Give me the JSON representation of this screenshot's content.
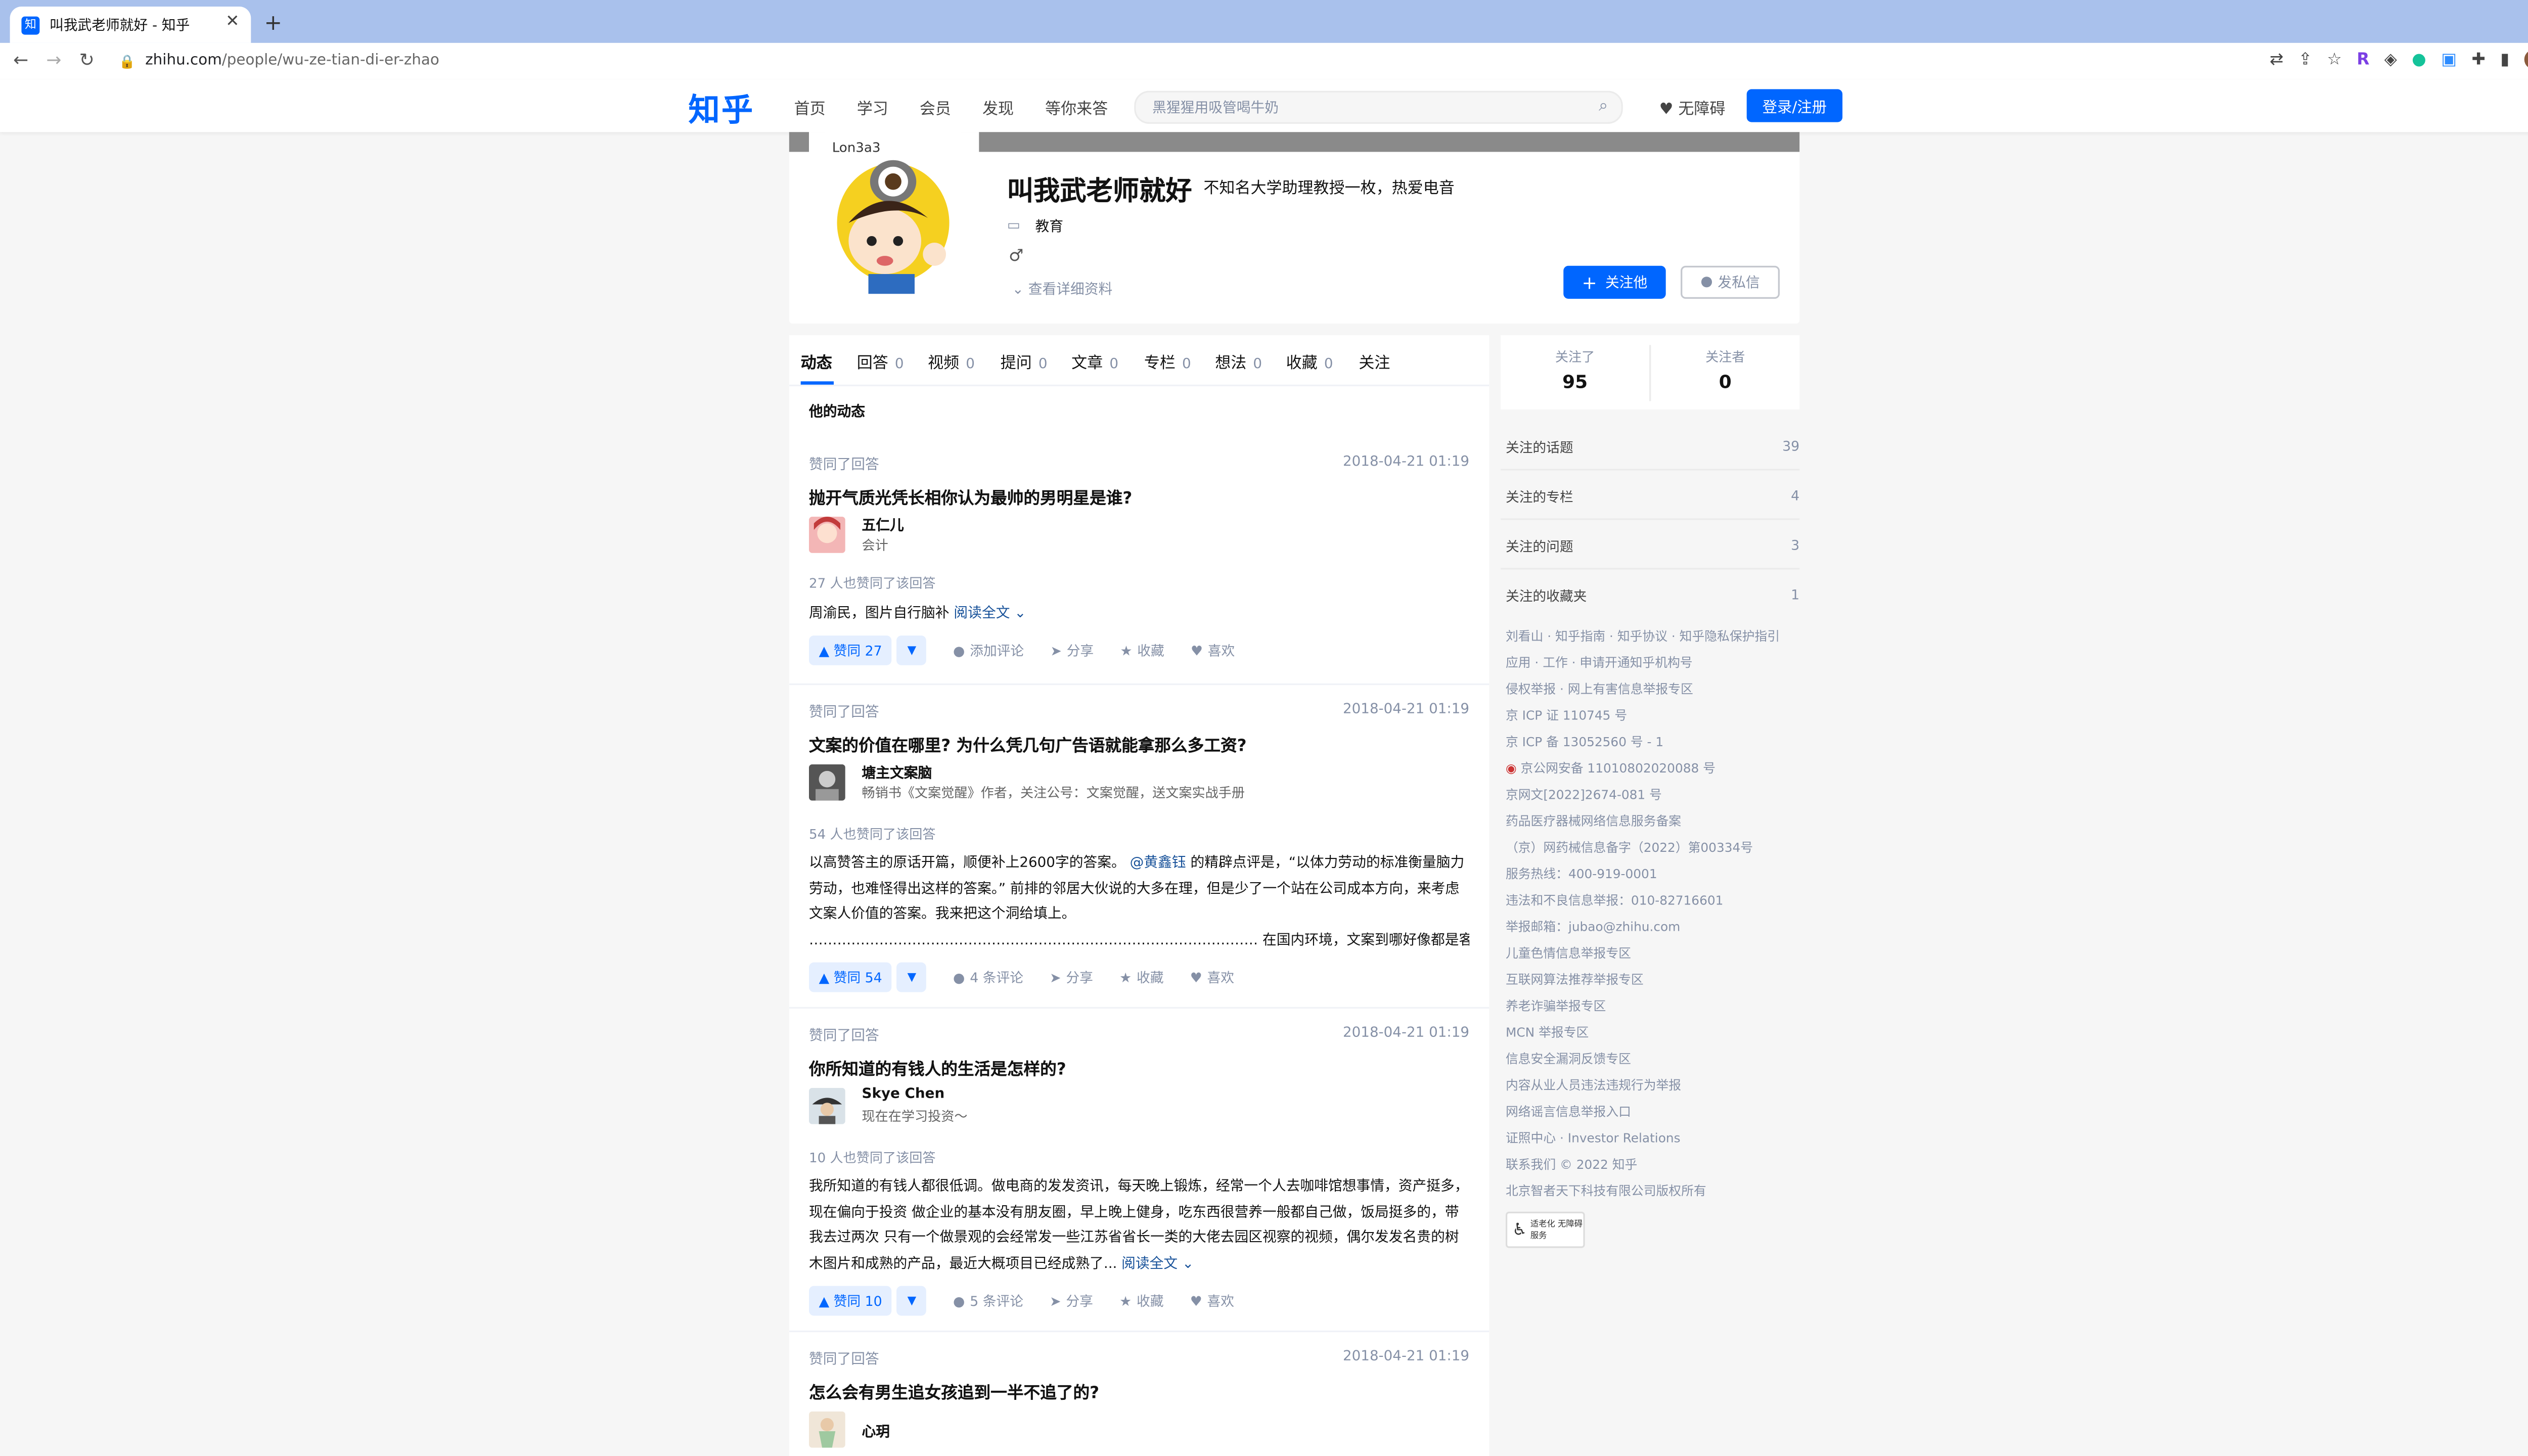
{
  "browser": {
    "tab_title": "叫我武老师就好 - 知乎",
    "tab_favicon": "知",
    "url_host": "zhihu.com",
    "url_path": "/people/wu-ze-tian-di-er-zhao",
    "profile_initial": "M"
  },
  "header": {
    "logo": "知乎",
    "nav": [
      "首页",
      "学习",
      "会员",
      "发现",
      "等你来答"
    ],
    "search_placeholder": "黑猩猩用吸管喝牛奶",
    "accessibility": "无障碍",
    "login": "登录/注册"
  },
  "profile": {
    "name": "叫我武老师就好",
    "headline": "不知名大学助理教授一枚，热爱电音",
    "industry": "教育",
    "gender_symbol": "♂",
    "more": "查看详细资料",
    "follow_btn": "关注他",
    "message_btn": "发私信"
  },
  "tabs": [
    {
      "label": "动态",
      "count": ""
    },
    {
      "label": "回答",
      "count": "0"
    },
    {
      "label": "视频",
      "count": "0"
    },
    {
      "label": "提问",
      "count": "0"
    },
    {
      "label": "文章",
      "count": "0"
    },
    {
      "label": "专栏",
      "count": "0"
    },
    {
      "label": "想法",
      "count": "0"
    },
    {
      "label": "收藏",
      "count": "0"
    },
    {
      "label": "关注",
      "count": ""
    }
  ],
  "feed_title": "他的动态",
  "feed": [
    {
      "action": "赞同了回答",
      "date": "2018-04-21 01:19",
      "question": "抛开气质光凭长相你认为最帅的男明星是谁?",
      "author": "五仁儿",
      "bio": "会计",
      "votes_line": "27 人也赞同了该回答",
      "excerpt": "周渝民，图片自行脑补",
      "read_more": "阅读全文 ⌄",
      "vote_label": "▲ 赞同 27",
      "comment_label": "添加评论",
      "share": "分享",
      "collect": "收藏",
      "like": "喜欢"
    },
    {
      "action": "赞同了回答",
      "date": "2018-04-21 01:19",
      "question": "文案的价值在哪里? 为什么凭几句广告语就能拿那么多工资?",
      "author": "塘主文案脑",
      "bio": "畅销书《文案觉醒》作者，关注公号：文案觉醒，送文案实战手册",
      "votes_line": "54 人也赞同了该回答",
      "excerpt_a": "以高赞答主的原话开篇，顺便补上2600字的答案。",
      "mention": "@黄鑫钰",
      "excerpt_b": " 的精辟点评是，“以体力劳动的标准衡量脑力劳动，也难怪得出这样的答案。” 前排的邻居大伙说的大多在理，但是少了一个站在公司成本方向，来考虑文案人价值的答案。我来把这个洞给填上。",
      "excerpt_c": "…………………………………………………………………………………… 在国内环境，文案到哪好像都是客...",
      "vote_label": "▲ 赞同 54",
      "comment_label": "4 条评论",
      "share": "分享",
      "collect": "收藏",
      "like": "喜欢"
    },
    {
      "action": "赞同了回答",
      "date": "2018-04-21 01:19",
      "question": "你所知道的有钱人的生活是怎样的?",
      "author": "Skye Chen",
      "bio": "现在在学习投资～",
      "votes_line": "10 人也赞同了该回答",
      "excerpt": "我所知道的有钱人都很低调。做电商的发发资讯，每天晚上锻炼，经常一个人去咖啡馆想事情，资产挺多，现在偏向于投资 做企业的基本没有朋友圈，早上晚上健身，吃东西很营养一般都自己做，饭局挺多的，带我去过两次 只有一个做景观的会经常发一些江苏省省长一类的大佬去园区视察的视频，偶尔发发名贵的树木图片和成熟的产品，最近大概项目已经成熟了...",
      "read_more": "阅读全文 ⌄",
      "vote_label": "▲ 赞同 10",
      "comment_label": "5 条评论",
      "share": "分享",
      "collect": "收藏",
      "like": "喜欢"
    },
    {
      "action": "赞同了回答",
      "date": "2018-04-21 01:19",
      "question": "怎么会有男生追女孩追到一半不追了的?",
      "author": "心玥"
    }
  ],
  "sidebar": {
    "following_label": "关注了",
    "following_count": "95",
    "followers_label": "关注者",
    "followers_count": "0",
    "rows": [
      {
        "k": "关注的话题",
        "v": "39"
      },
      {
        "k": "关注的专栏",
        "v": "4"
      },
      {
        "k": "关注的问题",
        "v": "3"
      },
      {
        "k": "关注的收藏夹",
        "v": "1"
      }
    ],
    "footer": [
      "刘看山 · 知乎指南 · 知乎协议 · 知乎隐私保护指引",
      "应用 · 工作 · 申请开通知乎机构号",
      "侵权举报 · 网上有害信息举报专区",
      "京 ICP 证 110745 号",
      "京 ICP 备 13052560 号 - 1",
      "京公网安备 11010802020088 号",
      "京网文[2022]2674-081 号",
      "药品医疗器械网络信息服务备案",
      "（京）网药械信息备字（2022）第00334号",
      "服务热线：400-919-0001",
      "违法和不良信息举报：010-82716601",
      "举报邮箱：jubao@zhihu.com",
      "儿童色情信息举报专区",
      "互联网算法推荐举报专区",
      "养老诈骗举报专区",
      "MCN 举报专区",
      "信息安全漏洞反馈专区",
      "内容从业人员违法违规行为举报",
      "网络谣言信息举报入口",
      "证照中心 · Investor Relations",
      "联系我们 © 2022 知乎",
      "北京智者天下科技有限公司版权所有"
    ],
    "badge_text": "适老化 无障碍服务"
  }
}
